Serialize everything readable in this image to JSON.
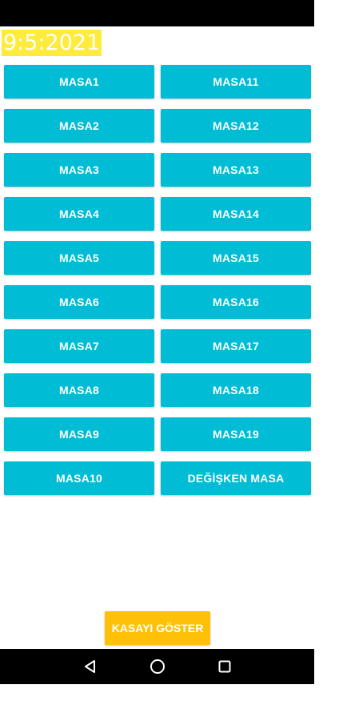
{
  "date_text": "9:5:2021",
  "tables": [
    {
      "left": "MASA1",
      "right": "MASA11"
    },
    {
      "left": "MASA2",
      "right": "MASA12"
    },
    {
      "left": "MASA3",
      "right": "MASA13"
    },
    {
      "left": "MASA4",
      "right": "MASA14"
    },
    {
      "left": "MASA5",
      "right": "MASA15"
    },
    {
      "left": "MASA6",
      "right": "MASA16"
    },
    {
      "left": "MASA7",
      "right": "MASA17"
    },
    {
      "left": "MASA8",
      "right": "MASA18"
    },
    {
      "left": "MASA9",
      "right": "MASA19"
    },
    {
      "left": "MASA10",
      "right": "DEĞİŞKEN MASA"
    }
  ],
  "cash_button_label": "KASAYI GÖSTER",
  "nav": {
    "back_icon": "back-triangle-icon",
    "home_icon": "home-circle-icon",
    "recent_icon": "recent-apps-square-icon"
  },
  "colors": {
    "table_button": "#00bcd4",
    "cash_button": "#ffc107",
    "date_background": "#ffeb3b"
  }
}
